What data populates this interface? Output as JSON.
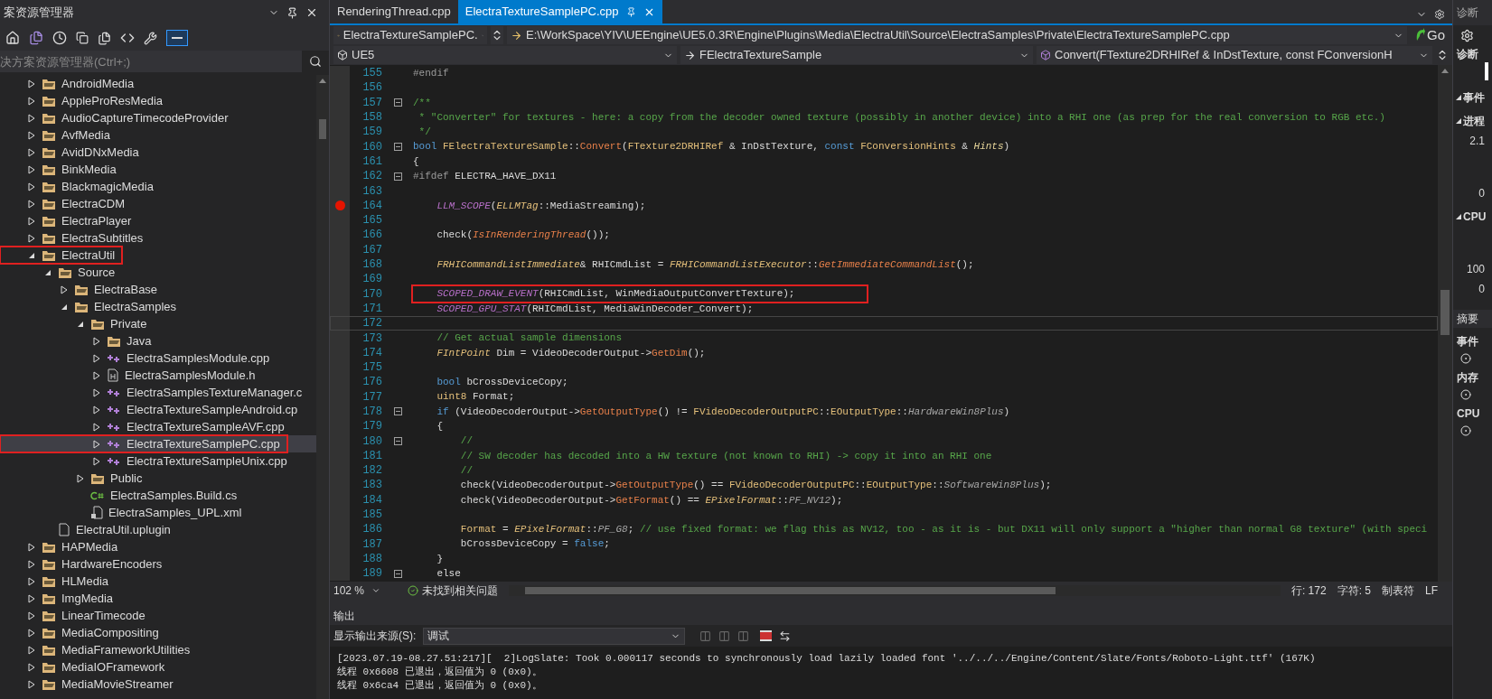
{
  "solution_explorer": {
    "title": "案资源管理器",
    "search": {
      "placeholder": "决方案资源管理器(Ctrl+;)"
    },
    "tree": [
      {
        "name": "AndroidMedia",
        "kind": "folder",
        "expanded": false,
        "selected": false,
        "annotated": false
      },
      {
        "name": "AppleProResMedia",
        "kind": "folder",
        "expanded": false,
        "selected": false,
        "annotated": false
      },
      {
        "name": "AudioCaptureTimecodeProvider",
        "kind": "folder",
        "expanded": false,
        "selected": false,
        "annotated": false
      },
      {
        "name": "AvfMedia",
        "kind": "folder",
        "expanded": false,
        "selected": false,
        "annotated": false
      },
      {
        "name": "AvidDNxMedia",
        "kind": "folder",
        "expanded": false,
        "selected": false,
        "annotated": false
      },
      {
        "name": "BinkMedia",
        "kind": "folder",
        "expanded": false,
        "selected": false,
        "annotated": false
      },
      {
        "name": "BlackmagicMedia",
        "kind": "folder",
        "expanded": false,
        "selected": false,
        "annotated": false
      },
      {
        "name": "ElectraCDM",
        "kind": "folder",
        "expanded": false,
        "selected": false,
        "annotated": false
      },
      {
        "name": "ElectraPlayer",
        "kind": "folder",
        "expanded": false,
        "selected": false,
        "annotated": false
      },
      {
        "name": "ElectraSubtitles",
        "kind": "folder",
        "expanded": false,
        "selected": false,
        "annotated": false
      },
      {
        "name": "ElectraUtil",
        "kind": "folder",
        "expanded": true,
        "selected": false,
        "annotated": true,
        "children": [
          {
            "name": "Source",
            "kind": "folder",
            "expanded": true,
            "selected": false,
            "annotated": false,
            "children": [
              {
                "name": "ElectraBase",
                "kind": "folder",
                "expanded": false,
                "selected": false,
                "annotated": false
              },
              {
                "name": "ElectraSamples",
                "kind": "folder",
                "expanded": true,
                "selected": false,
                "annotated": false,
                "children": [
                  {
                    "name": "Private",
                    "kind": "folder",
                    "expanded": true,
                    "selected": false,
                    "annotated": false,
                    "children": [
                      {
                        "name": "Java",
                        "kind": "folder",
                        "expanded": false,
                        "selected": false,
                        "annotated": false
                      },
                      {
                        "name": "ElectraSamplesModule.cpp",
                        "kind": "cpp",
                        "expanded": false,
                        "selected": false,
                        "annotated": false
                      },
                      {
                        "name": "ElectraSamplesModule.h",
                        "kind": "h",
                        "expanded": false,
                        "selected": false,
                        "annotated": false
                      },
                      {
                        "name": "ElectraSamplesTextureManager.c",
                        "kind": "cpp",
                        "expanded": false,
                        "selected": false,
                        "annotated": false
                      },
                      {
                        "name": "ElectraTextureSampleAndroid.cp",
                        "kind": "cpp",
                        "expanded": false,
                        "selected": false,
                        "annotated": false
                      },
                      {
                        "name": "ElectraTextureSampleAVF.cpp",
                        "kind": "cpp",
                        "expanded": false,
                        "selected": false,
                        "annotated": false
                      },
                      {
                        "name": "ElectraTextureSamplePC.cpp",
                        "kind": "cpp",
                        "expanded": false,
                        "selected": true,
                        "annotated": true
                      },
                      {
                        "name": "ElectraTextureSampleUnix.cpp",
                        "kind": "cpp",
                        "expanded": false,
                        "selected": false,
                        "annotated": false
                      }
                    ]
                  },
                  {
                    "name": "Public",
                    "kind": "folder",
                    "expanded": false,
                    "selected": false,
                    "annotated": false
                  },
                  {
                    "name": "ElectraSamples.Build.cs",
                    "kind": "cs",
                    "selected": false,
                    "annotated": false
                  },
                  {
                    "name": "ElectraSamples_UPL.xml",
                    "kind": "xml",
                    "selected": false,
                    "annotated": false
                  }
                ]
              }
            ]
          },
          {
            "name": "ElectraUtil.uplugin",
            "kind": "file",
            "selected": false,
            "annotated": false
          }
        ]
      },
      {
        "name": "HAPMedia",
        "kind": "folder",
        "expanded": false,
        "selected": false,
        "annotated": false
      },
      {
        "name": "HardwareEncoders",
        "kind": "folder",
        "expanded": false,
        "selected": false,
        "annotated": false
      },
      {
        "name": "HLMedia",
        "kind": "folder",
        "expanded": false,
        "selected": false,
        "annotated": false
      },
      {
        "name": "ImgMedia",
        "kind": "folder",
        "expanded": false,
        "selected": false,
        "annotated": false
      },
      {
        "name": "LinearTimecode",
        "kind": "folder",
        "expanded": false,
        "selected": false,
        "annotated": false
      },
      {
        "name": "MediaCompositing",
        "kind": "folder",
        "expanded": false,
        "selected": false,
        "annotated": false
      },
      {
        "name": "MediaFrameworkUtilities",
        "kind": "folder",
        "expanded": false,
        "selected": false,
        "annotated": false
      },
      {
        "name": "MediaIOFramework",
        "kind": "folder",
        "expanded": false,
        "selected": false,
        "annotated": false
      },
      {
        "name": "MediaMovieStreamer",
        "kind": "folder",
        "expanded": false,
        "selected": false,
        "annotated": false
      }
    ]
  },
  "editor": {
    "tabs": [
      {
        "label": "RenderingThread.cpp",
        "selected": false
      },
      {
        "label": "ElectraTextureSamplePC.cpp",
        "selected": true
      }
    ],
    "file_dropdown": "ElectraTextureSamplePC.",
    "path": "E:\\WorkSpace\\YIV\\UEEngine\\UE5.0.3R\\Engine\\Plugins\\Media\\ElectraUtil\\Source\\ElectraSamples\\Private\\ElectraTextureSamplePC.cpp",
    "go": "Go",
    "project": "UE5",
    "scope": "FElectraTextureSample",
    "member": "Convert(FTexture2DRHIRef & InDstTexture, const FConversionH",
    "lines": [
      {
        "number": "155",
        "breakpoint": false,
        "fold": false,
        "annotated": false,
        "current": false,
        "tokens": [
          {
            "text": "#endif",
            "kind": "pre"
          }
        ]
      },
      {
        "number": "156",
        "breakpoint": false,
        "fold": false,
        "annotated": false,
        "current": false
      },
      {
        "number": "157",
        "breakpoint": false,
        "fold": true,
        "annotated": false,
        "current": false,
        "tokens": [
          {
            "text": "/**",
            "kind": "comment"
          }
        ]
      },
      {
        "number": "158",
        "breakpoint": false,
        "fold": false,
        "annotated": false,
        "current": false,
        "tokens": [
          {
            "text": " * \"Converter\" for textures - here: a copy from the decoder owned texture (possibly in another device) into a RHI one (as prep for the real conversion to RGB etc.)",
            "kind": "comment"
          }
        ]
      },
      {
        "number": "159",
        "breakpoint": false,
        "fold": false,
        "annotated": false,
        "current": false,
        "tokens": [
          {
            "text": " */",
            "kind": "comment"
          }
        ]
      },
      {
        "number": "160",
        "breakpoint": false,
        "fold": true,
        "annotated": false,
        "current": false,
        "tokens": [
          {
            "text": "bool",
            "kind": "kw"
          },
          {
            "text": " FElectraTextureSample",
            "kind": "type"
          },
          {
            "text": "::",
            "kind": "plain"
          },
          {
            "text": "Convert",
            "kind": "func"
          },
          {
            "text": "(",
            "kind": "plain"
          },
          {
            "text": "FTexture2DRHIRef",
            "kind": "type"
          },
          {
            "text": " & InDstTexture, ",
            "kind": "plain"
          },
          {
            "text": "const",
            "kind": "kw"
          },
          {
            "text": " FConversionHints",
            "kind": "type"
          },
          {
            "text": " & ",
            "kind": "plain"
          },
          {
            "text": "Hints",
            "kind": "param"
          },
          {
            "text": ")",
            "kind": "plain"
          }
        ]
      },
      {
        "number": "161",
        "breakpoint": false,
        "fold": false,
        "annotated": false,
        "current": false,
        "tokens": [
          {
            "text": "{",
            "kind": "plain"
          }
        ]
      },
      {
        "number": "162",
        "breakpoint": false,
        "fold": true,
        "annotated": false,
        "current": false,
        "tokens": [
          {
            "text": "#ifdef",
            "kind": "pre"
          },
          {
            "text": " ELECTRA_HAVE_DX11",
            "kind": "plain"
          }
        ]
      },
      {
        "number": "163",
        "breakpoint": false,
        "fold": false,
        "annotated": false,
        "current": false
      },
      {
        "number": "164",
        "breakpoint": true,
        "fold": false,
        "annotated": false,
        "current": false,
        "tokens": [
          {
            "text": "    LLM_SCOPE",
            "kind": "macro"
          },
          {
            "text": "(",
            "kind": "plain"
          },
          {
            "text": "ELLMTag",
            "kind": "typei"
          },
          {
            "text": "::MediaStreaming);",
            "kind": "plain"
          }
        ]
      },
      {
        "number": "165",
        "breakpoint": false,
        "fold": false,
        "annotated": false,
        "current": false
      },
      {
        "number": "166",
        "breakpoint": false,
        "fold": false,
        "annotated": false,
        "current": false,
        "tokens": [
          {
            "text": "    check(",
            "kind": "plain"
          },
          {
            "text": "IsInRenderingThread",
            "kind": "funci"
          },
          {
            "text": "());",
            "kind": "plain"
          }
        ]
      },
      {
        "number": "167",
        "breakpoint": false,
        "fold": false,
        "annotated": false,
        "current": false
      },
      {
        "number": "168",
        "breakpoint": false,
        "fold": false,
        "annotated": false,
        "current": false,
        "tokens": [
          {
            "text": "    FRHICommandListImmediate",
            "kind": "typei"
          },
          {
            "text": "& RHICmdList = ",
            "kind": "plain"
          },
          {
            "text": "FRHICommandListExecutor",
            "kind": "typei"
          },
          {
            "text": "::",
            "kind": "plain"
          },
          {
            "text": "GetImmediateCommandList",
            "kind": "funci"
          },
          {
            "text": "();",
            "kind": "plain"
          }
        ]
      },
      {
        "number": "169",
        "breakpoint": false,
        "fold": false,
        "annotated": false,
        "current": false
      },
      {
        "number": "170",
        "breakpoint": false,
        "fold": false,
        "annotated": true,
        "current": false,
        "tokens": [
          {
            "text": "    SCOPED_DRAW_EVENT",
            "kind": "macro"
          },
          {
            "text": "(RHICmdList, WinMediaOutputConvertTexture);",
            "kind": "plain"
          }
        ]
      },
      {
        "number": "171",
        "breakpoint": false,
        "fold": false,
        "annotated": false,
        "current": false,
        "tokens": [
          {
            "text": "    SCOPED_GPU_STAT",
            "kind": "macro"
          },
          {
            "text": "(RHICmdList, MediaWinDecoder_Convert);",
            "kind": "plain"
          }
        ]
      },
      {
        "number": "172",
        "breakpoint": false,
        "fold": false,
        "annotated": false,
        "current": true
      },
      {
        "number": "173",
        "breakpoint": false,
        "fold": false,
        "annotated": false,
        "current": false,
        "tokens": [
          {
            "text": "    // Get actual sample dimensions",
            "kind": "comment"
          }
        ]
      },
      {
        "number": "174",
        "breakpoint": false,
        "fold": false,
        "annotated": false,
        "current": false,
        "tokens": [
          {
            "text": "    FIntPoint",
            "kind": "typei"
          },
          {
            "text": " Dim = VideoDecoderOutput->",
            "kind": "plain"
          },
          {
            "text": "GetDim",
            "kind": "func"
          },
          {
            "text": "();",
            "kind": "plain"
          }
        ]
      },
      {
        "number": "175",
        "breakpoint": false,
        "fold": false,
        "annotated": false,
        "current": false
      },
      {
        "number": "176",
        "breakpoint": false,
        "fold": false,
        "annotated": false,
        "current": false,
        "tokens": [
          {
            "text": "    bool",
            "kind": "kw"
          },
          {
            "text": " bCrossDeviceCopy;",
            "kind": "plain"
          }
        ]
      },
      {
        "number": "177",
        "breakpoint": false,
        "fold": false,
        "annotated": false,
        "current": false,
        "tokens": [
          {
            "text": "    uint8",
            "kind": "type"
          },
          {
            "text": " Format;",
            "kind": "plain"
          }
        ]
      },
      {
        "number": "178",
        "breakpoint": false,
        "fold": true,
        "annotated": false,
        "current": false,
        "tokens": [
          {
            "text": "    if",
            "kind": "kw"
          },
          {
            "text": " (VideoDecoderOutput->",
            "kind": "plain"
          },
          {
            "text": "GetOutputType",
            "kind": "func"
          },
          {
            "text": "() != ",
            "kind": "plain"
          },
          {
            "text": "FVideoDecoderOutputPC",
            "kind": "type"
          },
          {
            "text": "::",
            "kind": "plain"
          },
          {
            "text": "EOutputType",
            "kind": "type"
          },
          {
            "text": "::",
            "kind": "plain"
          },
          {
            "text": "HardwareWin8Plus",
            "kind": "enum"
          },
          {
            "text": ")",
            "kind": "plain"
          }
        ]
      },
      {
        "number": "179",
        "breakpoint": false,
        "fold": false,
        "annotated": false,
        "current": false,
        "tokens": [
          {
            "text": "    {",
            "kind": "plain"
          }
        ]
      },
      {
        "number": "180",
        "breakpoint": false,
        "fold": true,
        "annotated": false,
        "current": false,
        "tokens": [
          {
            "text": "        //",
            "kind": "comment"
          }
        ]
      },
      {
        "number": "181",
        "breakpoint": false,
        "fold": false,
        "annotated": false,
        "current": false,
        "tokens": [
          {
            "text": "        // SW decoder has decoded into a HW texture (not known to RHI) -> copy it into an RHI one",
            "kind": "comment"
          }
        ]
      },
      {
        "number": "182",
        "breakpoint": false,
        "fold": false,
        "annotated": false,
        "current": false,
        "tokens": [
          {
            "text": "        //",
            "kind": "comment"
          }
        ]
      },
      {
        "number": "183",
        "breakpoint": false,
        "fold": false,
        "annotated": false,
        "current": false,
        "tokens": [
          {
            "text": "        check(VideoDecoderOutput->",
            "kind": "plain"
          },
          {
            "text": "GetOutputType",
            "kind": "func"
          },
          {
            "text": "() == ",
            "kind": "plain"
          },
          {
            "text": "FVideoDecoderOutputPC",
            "kind": "type"
          },
          {
            "text": "::",
            "kind": "plain"
          },
          {
            "text": "EOutputType",
            "kind": "type"
          },
          {
            "text": "::",
            "kind": "plain"
          },
          {
            "text": "SoftwareWin8Plus",
            "kind": "enum"
          },
          {
            "text": ");",
            "kind": "plain"
          }
        ]
      },
      {
        "number": "184",
        "breakpoint": false,
        "fold": false,
        "annotated": false,
        "current": false,
        "tokens": [
          {
            "text": "        check(VideoDecoderOutput->",
            "kind": "plain"
          },
          {
            "text": "GetFormat",
            "kind": "func"
          },
          {
            "text": "() == ",
            "kind": "plain"
          },
          {
            "text": "EPixelFormat",
            "kind": "typei"
          },
          {
            "text": "::",
            "kind": "plain"
          },
          {
            "text": "PF_NV12",
            "kind": "enum"
          },
          {
            "text": ");",
            "kind": "plain"
          }
        ]
      },
      {
        "number": "185",
        "breakpoint": false,
        "fold": false,
        "annotated": false,
        "current": false
      },
      {
        "number": "186",
        "breakpoint": false,
        "fold": false,
        "annotated": false,
        "current": false,
        "tokens": [
          {
            "text": "        Format",
            "kind": "type"
          },
          {
            "text": " = ",
            "kind": "plain"
          },
          {
            "text": "EPixelFormat",
            "kind": "typei"
          },
          {
            "text": "::",
            "kind": "plain"
          },
          {
            "text": "PF_G8",
            "kind": "enum"
          },
          {
            "text": "; ",
            "kind": "plain"
          },
          {
            "text": "// use fixed format: we flag this as NV12, too - as it is - but DX11 will only support a \"higher than normal G8 texture\" (with speci",
            "kind": "comment"
          }
        ]
      },
      {
        "number": "187",
        "breakpoint": false,
        "fold": false,
        "annotated": false,
        "current": false,
        "tokens": [
          {
            "text": "        bCrossDeviceCopy = ",
            "kind": "plain"
          },
          {
            "text": "false",
            "kind": "kw"
          },
          {
            "text": ";",
            "kind": "plain"
          }
        ]
      },
      {
        "number": "188",
        "breakpoint": false,
        "fold": false,
        "annotated": false,
        "current": false,
        "tokens": [
          {
            "text": "    }",
            "kind": "plain"
          }
        ]
      },
      {
        "number": "189",
        "breakpoint": false,
        "fold": true,
        "annotated": false,
        "current": false,
        "tokens": [
          {
            "text": "    else",
            "kind": "plain"
          }
        ]
      }
    ],
    "status": {
      "zoom": "102 %",
      "issues": "未找到相关问题",
      "line": "行: 172",
      "char": "字符: 5",
      "tabs": "制表符",
      "eol": "LF"
    }
  },
  "output": {
    "title": "输出",
    "source_label": "显示输出来源(S):",
    "source": "调试",
    "log": [
      "[2023.07.19-08.27.51:217][  2]LogSlate: Took 0.000117 seconds to synchronously load lazily loaded font '../../../Engine/Content/Slate/Fonts/Roboto-Light.ttf' (167K)",
      "线程 0x6608 已退出，返回值为 0 (0x0)。",
      "线程 0x6ca4 已退出，返回值为 0 (0x0)。"
    ]
  },
  "diagnostics": {
    "title": "诊断",
    "subtitle": "诊断",
    "sections": [
      {
        "label": "事件",
        "kind": "header"
      },
      {
        "label": "进程",
        "kind": "header"
      },
      {
        "label": "2.1",
        "kind": "value"
      },
      {
        "label": "0",
        "kind": "value"
      },
      {
        "label": "CPU",
        "kind": "header"
      },
      {
        "label": "100",
        "kind": "value"
      },
      {
        "label": "0",
        "kind": "value"
      }
    ],
    "summary": "摘要",
    "summary_items": [
      "事件",
      "内存",
      "CPU"
    ]
  }
}
